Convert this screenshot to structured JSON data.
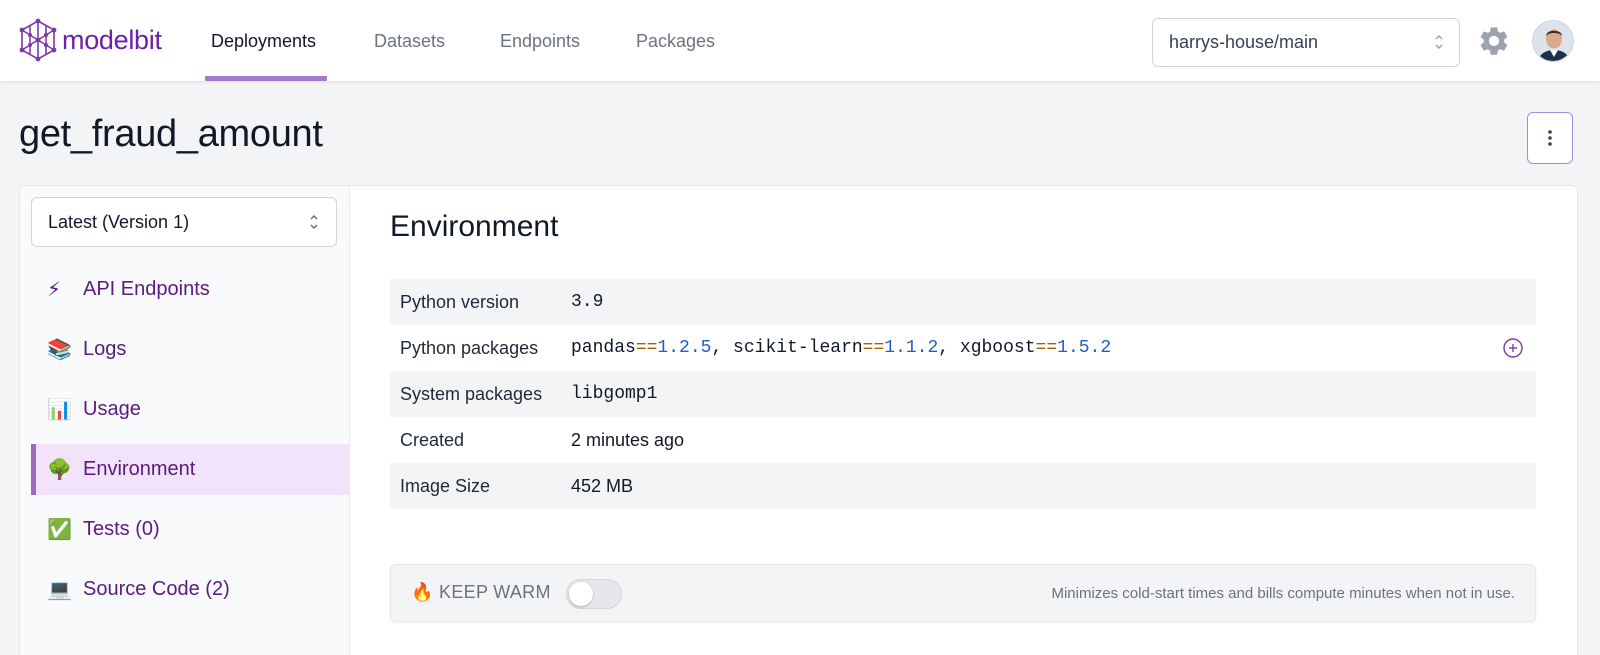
{
  "app": {
    "logo_text": "modelbit"
  },
  "nav": {
    "tabs": [
      {
        "label": "Deployments",
        "active": true
      },
      {
        "label": "Datasets",
        "active": false
      },
      {
        "label": "Endpoints",
        "active": false
      },
      {
        "label": "Packages",
        "active": false
      }
    ],
    "branch": "harrys-house/main"
  },
  "page": {
    "title": "get_fraud_amount"
  },
  "sidebar": {
    "version_select": "Latest (Version 1)",
    "items": [
      {
        "emoji": "⚡",
        "label": "API Endpoints"
      },
      {
        "emoji": "📚",
        "label": "Logs"
      },
      {
        "emoji": "📊",
        "label": "Usage"
      },
      {
        "emoji": "🌳",
        "label": "Environment",
        "active": true
      },
      {
        "emoji": "✅",
        "label": "Tests (0)"
      },
      {
        "emoji": "💻",
        "label": "Source Code (2)"
      }
    ]
  },
  "environment": {
    "title": "Environment",
    "rows": {
      "python_version": {
        "label": "Python version",
        "value": "3.9"
      },
      "python_packages": {
        "label": "Python packages",
        "packages": [
          {
            "name": "pandas",
            "op": "==",
            "version": "1.2.5"
          },
          {
            "name": "scikit-learn",
            "op": "==",
            "version": "1.1.2"
          },
          {
            "name": "xgboost",
            "op": "==",
            "version": "1.5.2"
          }
        ],
        "separator": ", "
      },
      "system_packages": {
        "label": "System packages",
        "value": "libgomp1"
      },
      "created": {
        "label": "Created",
        "value": "2 minutes ago"
      },
      "image_size": {
        "label": "Image Size",
        "value": "452 MB"
      }
    }
  },
  "keep_warm": {
    "emoji": "🔥",
    "label": "KEEP WARM",
    "enabled": false,
    "description": "Minimizes cold-start times and bills compute minutes when not in use."
  },
  "colors": {
    "accent": "#9d6bbd",
    "brand": "#6b21a8",
    "number": "#1d5fc4",
    "operator": "#a16207"
  }
}
